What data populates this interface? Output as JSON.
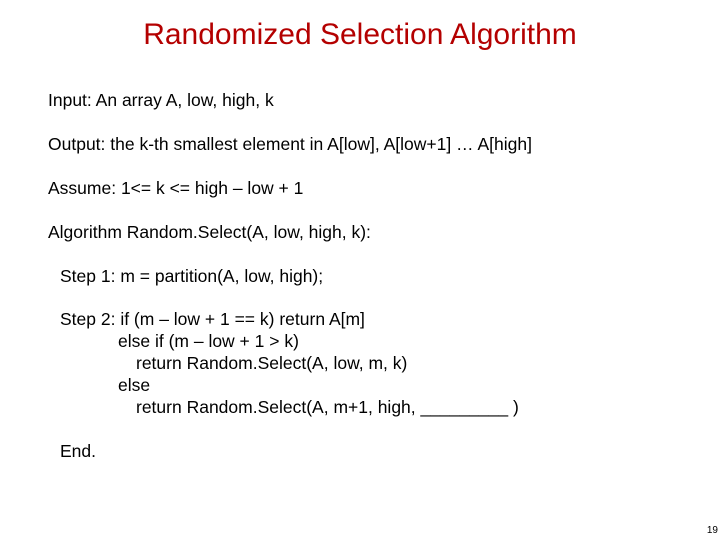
{
  "title": "Randomized Selection Algorithm",
  "input_line": "Input: An array A, low, high, k",
  "output_line": "Output: the k-th smallest element in A[low], A[low+1] … A[high]",
  "assume_line": "Assume: 1<= k <= high – low + 1",
  "algo_header": "Algorithm Random.Select(A, low, high, k):",
  "step1": "Step 1: m = partition(A, low, high);",
  "step2_l1": "Step 2: if (m – low + 1 == k) return A[m]",
  "step2_l2": "else if (m – low + 1 > k)",
  "step2_l3": "return Random.Select(A, low, m, k)",
  "step2_l4": "else",
  "step2_l5": "return Random.Select(A, m+1, high, _________ )",
  "end_line": "End.",
  "page_number": "19"
}
